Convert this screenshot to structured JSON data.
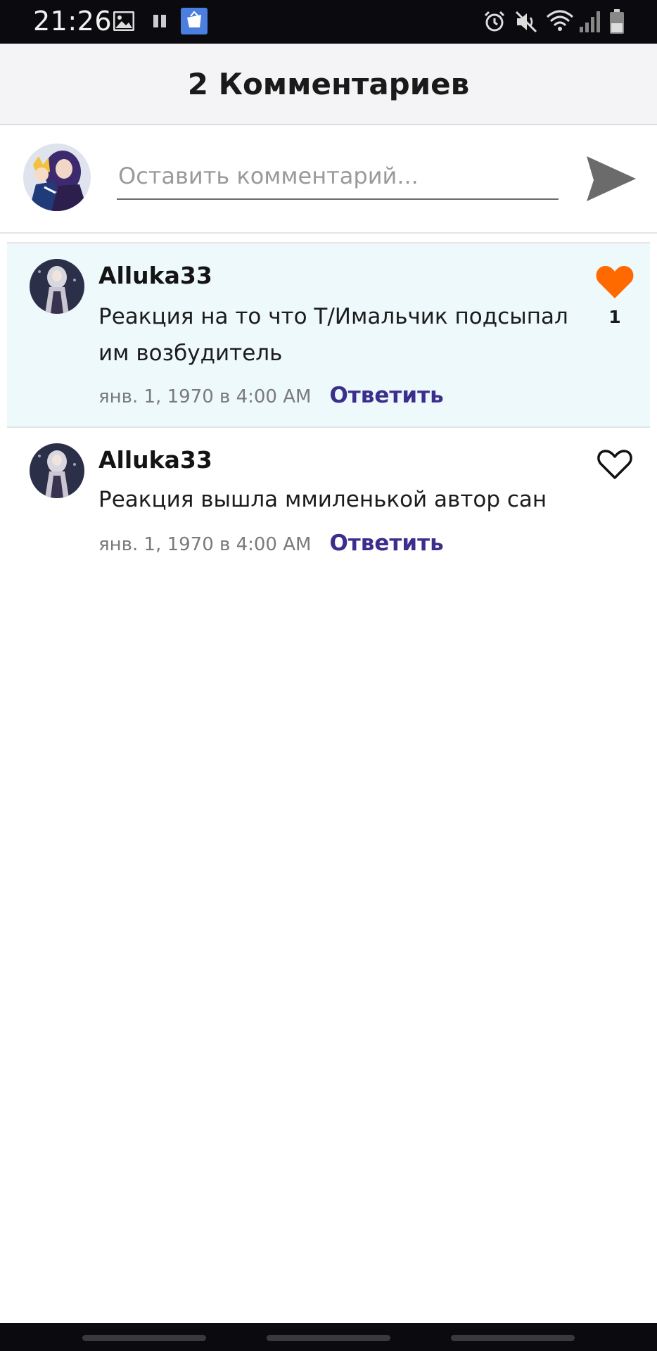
{
  "status_bar": {
    "time": "21:26",
    "icons": [
      "gallery-icon",
      "pause-icon",
      "app-notification-icon",
      "alarm-icon",
      "mute-icon",
      "wifi-icon",
      "signal-icon",
      "battery-icon"
    ]
  },
  "header": {
    "title": "2 Комментариев"
  },
  "composer": {
    "placeholder": "Оставить комментарий...",
    "value": "",
    "send_icon": "send-icon"
  },
  "comments": [
    {
      "user": "Alluka33",
      "text": "Реакция на то что Т/Имальчик подсыпал им возбудитель",
      "date": "янв. 1, 1970 в 4:00 AM",
      "reply_label": "Ответить",
      "liked": true,
      "like_count": "1",
      "highlighted": true
    },
    {
      "user": "Alluka33",
      "text": "Реакция вышла ммиленькой автор сан",
      "date": "янв. 1, 1970 в 4:00 AM",
      "reply_label": "Ответить",
      "liked": false,
      "like_count": "",
      "highlighted": false
    }
  ],
  "colors": {
    "accent_reply": "#3b2e8c",
    "like_active": "#ff6a00",
    "highlight_bg": "#eef9fc",
    "header_bg": "#f4f3f5"
  }
}
